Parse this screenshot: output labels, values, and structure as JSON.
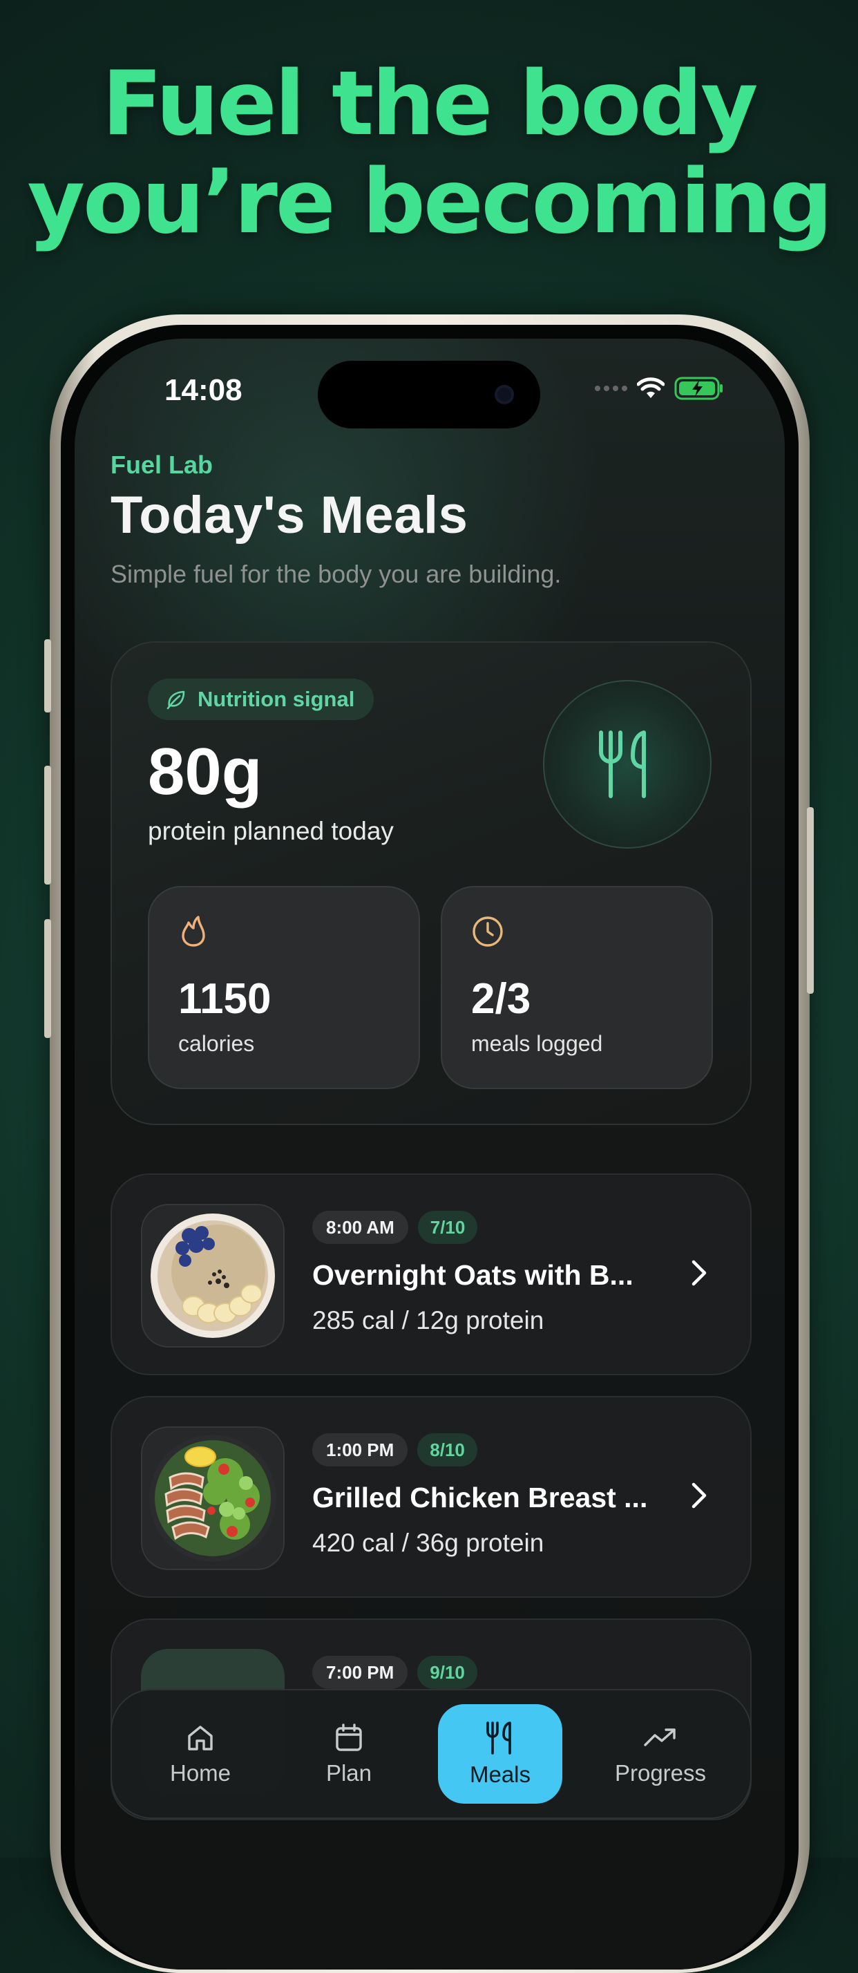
{
  "headline": {
    "line1": "Fuel the body",
    "line2": "you’re becoming"
  },
  "status_bar": {
    "time": "14:08"
  },
  "header": {
    "brand": "Fuel Lab",
    "title": "Today's Meals",
    "subtitle": "Simple fuel for the body you are building."
  },
  "summary": {
    "pill_label": "Nutrition signal",
    "protein_value": "80g",
    "protein_label": "protein planned today",
    "stats": [
      {
        "value": "1150",
        "label": "calories",
        "icon": "flame-icon"
      },
      {
        "value": "2/3",
        "label": "meals logged",
        "icon": "clock-icon"
      }
    ]
  },
  "meals": [
    {
      "time": "8:00 AM",
      "score": "7/10",
      "name": "Overnight Oats with B...",
      "macros": "285 cal / 12g protein"
    },
    {
      "time": "1:00 PM",
      "score": "8/10",
      "name": "Grilled Chicken Breast ...",
      "macros": "420 cal / 36g protein"
    },
    {
      "time": "7:00 PM",
      "score": "9/10"
    }
  ],
  "tabbar": {
    "tabs": [
      {
        "label": "Home",
        "icon": "home-icon",
        "active": false
      },
      {
        "label": "Plan",
        "icon": "calendar-icon",
        "active": false
      },
      {
        "label": "Meals",
        "icon": "utensils-icon",
        "active": true
      },
      {
        "label": "Progress",
        "icon": "trending-up-icon",
        "active": false
      }
    ]
  },
  "colors": {
    "accent_green": "#3ee28f",
    "active_tab": "#44c7f2",
    "background": "#121414"
  }
}
